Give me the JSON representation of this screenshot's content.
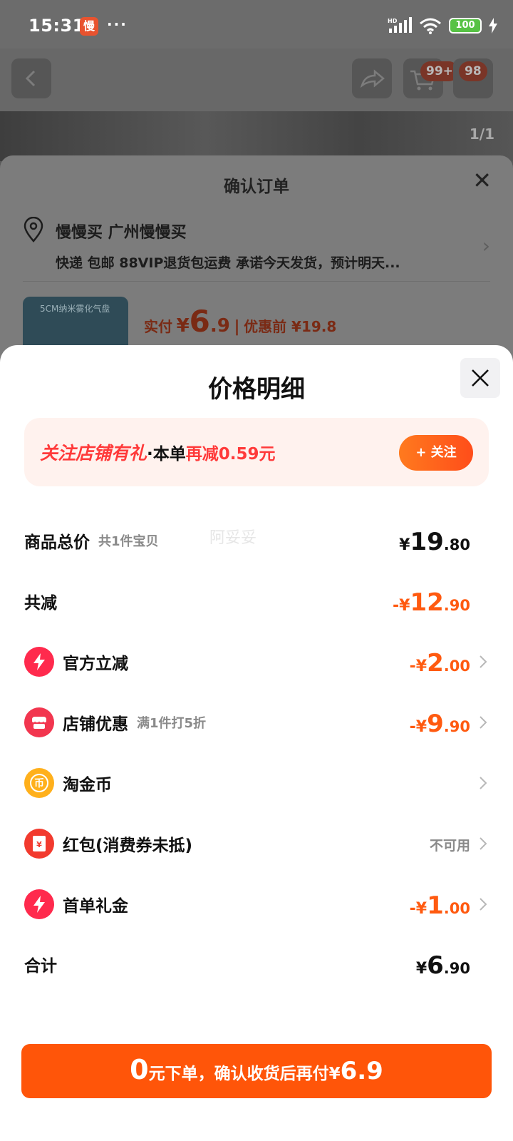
{
  "status_bar": {
    "time": "15:31",
    "app_badge": "慢",
    "dots": "···",
    "battery": "100"
  },
  "background": {
    "cart_badge": "99+",
    "msg_badge": "98",
    "photo_counter": "1/1",
    "order_title": "确认订单",
    "address_name": "慢慢买  广州慢慢买",
    "address_line": "快递 包邮 88VIP退货包运费 承诺今天发货，预计明天...",
    "thumb_text": "5CM纳米雾化气盘",
    "pay_label": "实付",
    "pay_currency": "¥",
    "pay_int": "6",
    "pay_dec": ".9",
    "pay_sep": "|",
    "before_label": "优惠前 ¥19.8"
  },
  "sheet": {
    "title": "价格明细",
    "promo": {
      "part1": "关注店铺有礼",
      "part2": "·本单",
      "part3": "再减0.59元",
      "button": "+ 关注"
    },
    "watermark": "阿妥妥",
    "rows": [
      {
        "label": "商品总价",
        "sub": "共1件宝贝",
        "sign": "¥",
        "int": "19",
        "dec": ".80"
      },
      {
        "label": "共减",
        "sign": "-¥",
        "int": "12",
        "dec": ".90"
      },
      {
        "label": "官方立减",
        "sign": "-¥",
        "int": "2",
        "dec": ".00",
        "icon": "lightning-icon"
      },
      {
        "label": "店铺优惠",
        "sub": "满1件打5折",
        "sign": "-¥",
        "int": "9",
        "dec": ".90",
        "icon": "store-icon"
      },
      {
        "label": "淘金币",
        "icon": "coin-icon"
      },
      {
        "label": "红包(消费券未抵)",
        "status": "不可用",
        "icon": "red-packet-icon"
      },
      {
        "label": "首单礼金",
        "sign": "-¥",
        "int": "1",
        "dec": ".00",
        "icon": "lightning-icon"
      },
      {
        "label": "合计",
        "sign": "¥",
        "int": "6",
        "dec": ".90"
      }
    ],
    "cta": {
      "zero": "0",
      "text": "元下单，确认收货后再付 ",
      "currency": "¥",
      "price": "6.9"
    }
  },
  "colors": {
    "accent": "#ff5509",
    "promo_red": "#ff3a3a",
    "promo_bg": "#fff2ee"
  }
}
